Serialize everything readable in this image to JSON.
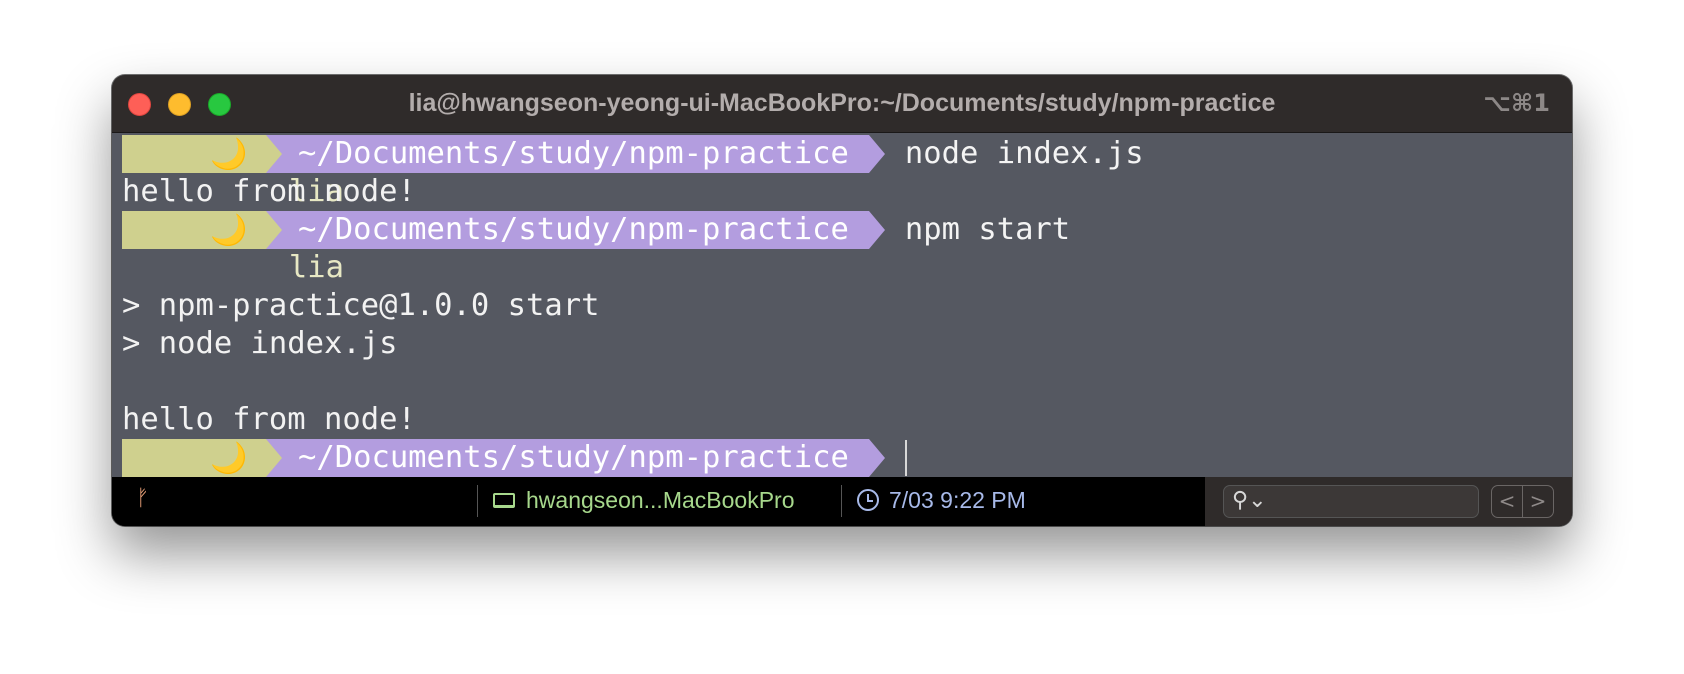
{
  "window": {
    "title": "lia@hwangseon-yeong-ui-MacBookPro:~/Documents/study/npm-practice",
    "shortcut": "⌥⌘1"
  },
  "prompt": {
    "user": "lia",
    "moon": "🌙",
    "path": "~/Documents/study/npm-practice"
  },
  "lines": [
    {
      "kind": "prompt",
      "command": "node index.js"
    },
    {
      "kind": "output",
      "text": "hello from node!"
    },
    {
      "kind": "prompt",
      "command": "npm start"
    },
    {
      "kind": "output",
      "text": ""
    },
    {
      "kind": "output",
      "text": "> npm-practice@1.0.0 start"
    },
    {
      "kind": "output",
      "text": "> node index.js"
    },
    {
      "kind": "output",
      "text": ""
    },
    {
      "kind": "output",
      "text": "hello from node!"
    },
    {
      "kind": "prompt",
      "command": ""
    }
  ],
  "statusbar": {
    "git_icon": "git-branch-icon",
    "host": "hwangseon...MacBookPro",
    "host_icon": "laptop-icon",
    "time": "7/03 9:22 PM",
    "time_icon": "clock-icon",
    "search_placeholder": "",
    "prev": "<",
    "next": ">"
  },
  "colors": {
    "terminal_bg": "#555861",
    "titlebar_bg": "#2f2b2a",
    "user_segment": "#cfd08e",
    "path_segment": "#b39ddf",
    "host_text": "#a7d88c",
    "time_text": "#a7b9e8"
  }
}
